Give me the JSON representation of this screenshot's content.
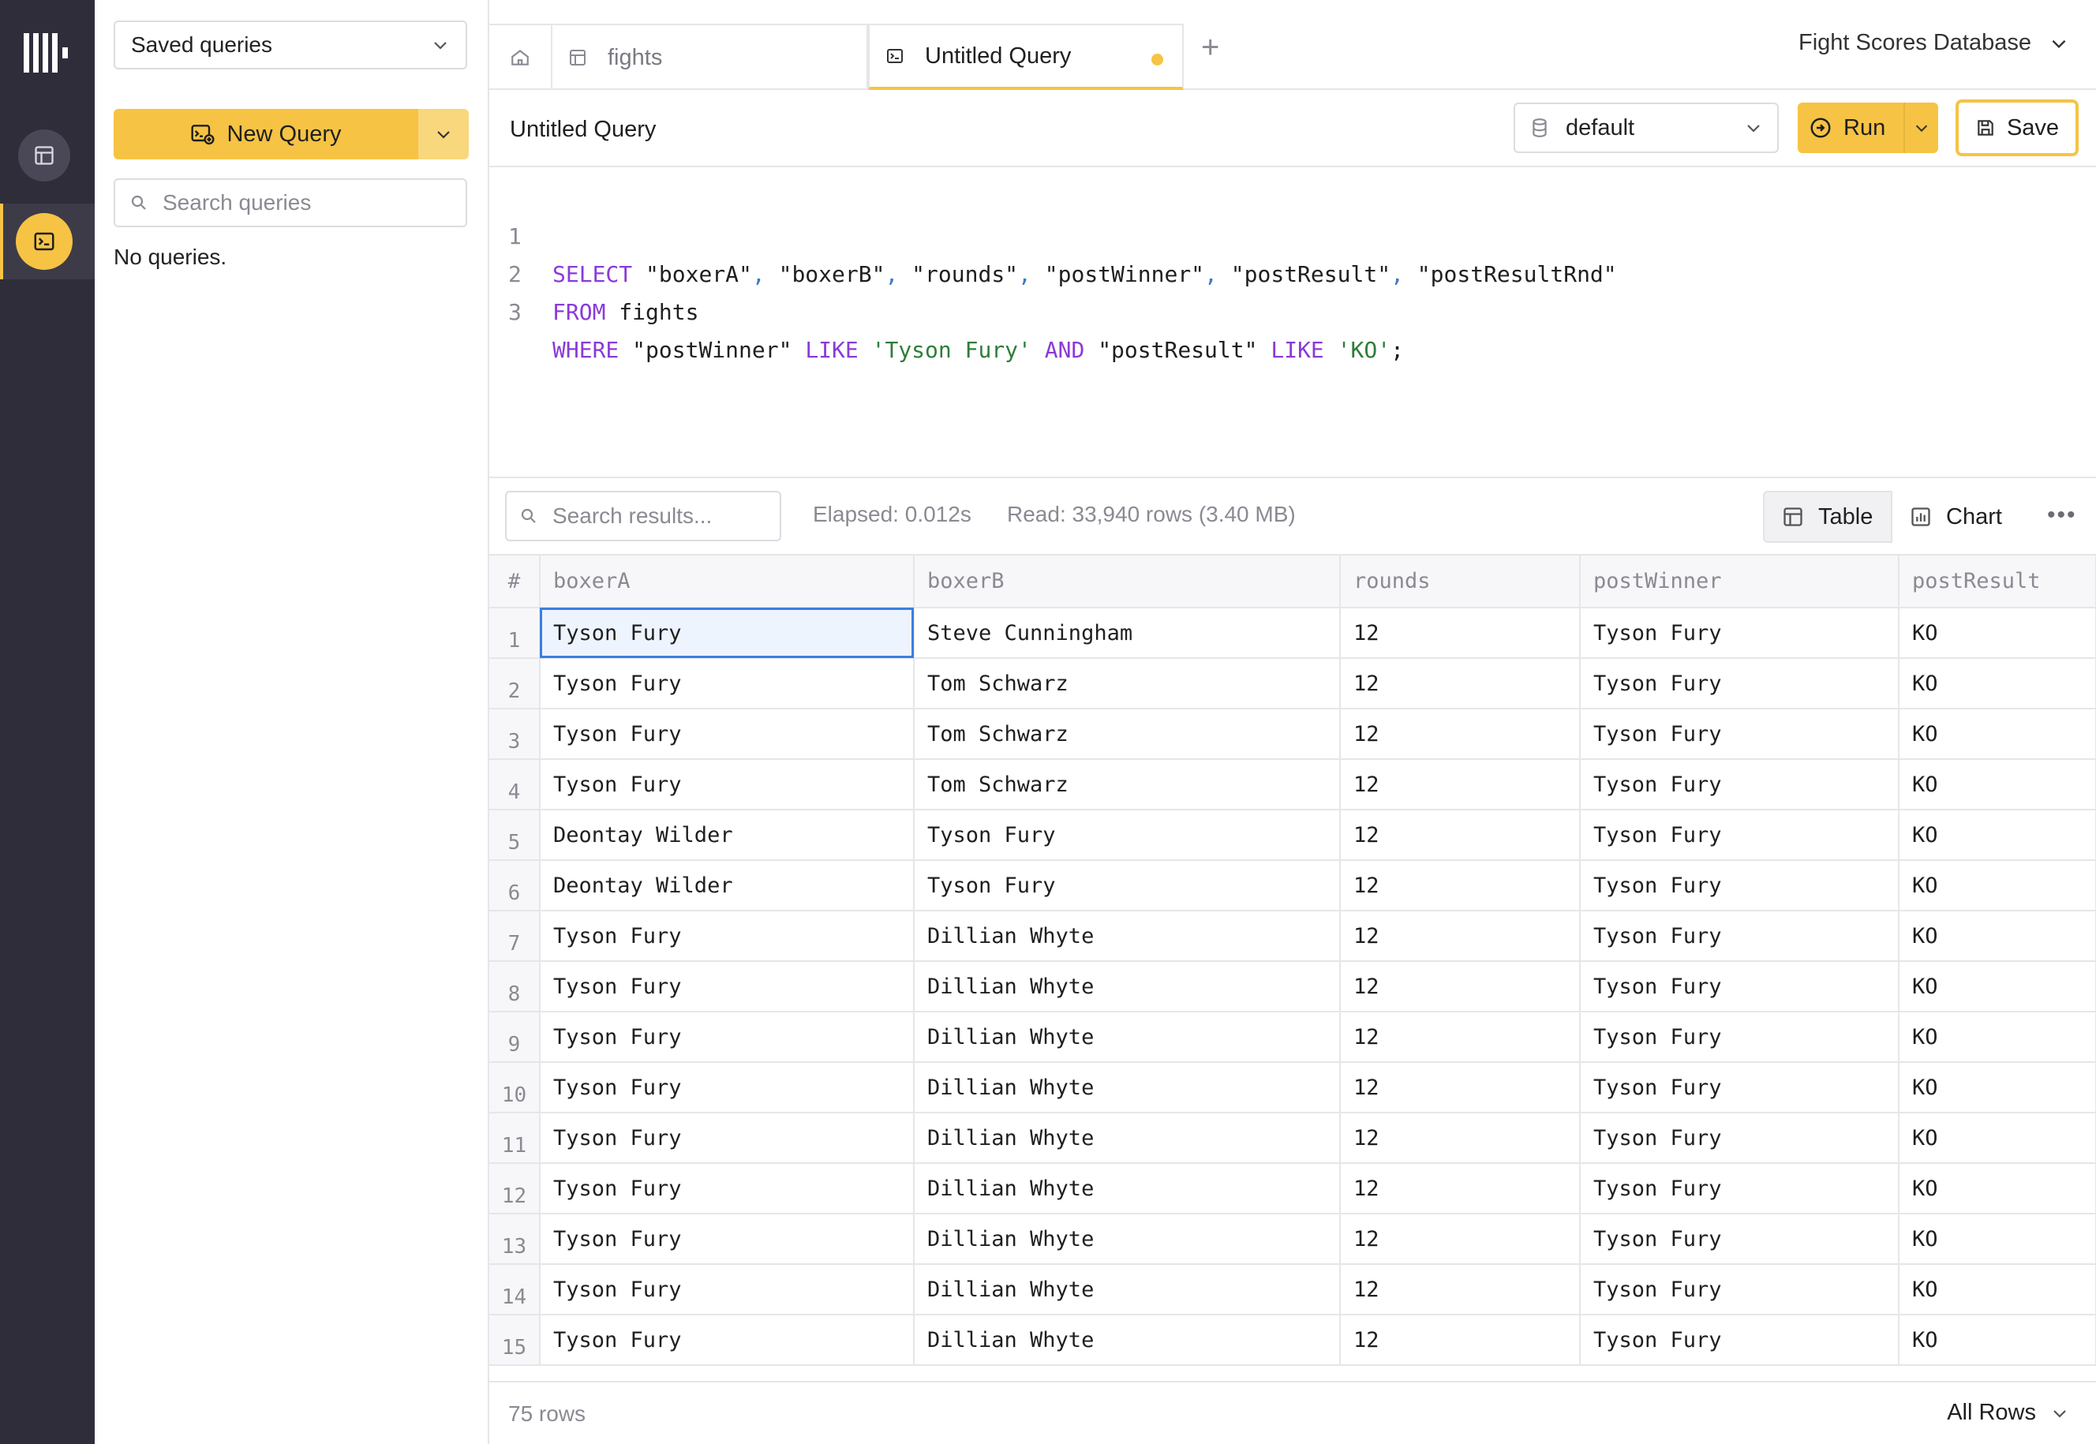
{
  "sidebar": {
    "saved_select_label": "Saved queries",
    "new_query_label": "New Query",
    "search_placeholder": "Search queries",
    "empty_text": "No queries."
  },
  "tabs": {
    "fights_label": "fights",
    "untitled_label": "Untitled Query",
    "database_label": "Fight Scores Database"
  },
  "query": {
    "title": "Untitled Query",
    "database": "default",
    "run_label": "Run",
    "save_label": "Save",
    "lines": [
      [
        "1",
        "SELECT \"boxerA\", \"boxerB\", \"rounds\", \"postWinner\", \"postResult\", \"postResultRnd\""
      ],
      [
        "2",
        "FROM fights"
      ],
      [
        "3",
        "WHERE \"postWinner\" LIKE 'Tyson Fury' AND \"postResult\" LIKE 'KO';"
      ]
    ]
  },
  "results": {
    "search_placeholder": "Search results...",
    "elapsed": "Elapsed: 0.012s",
    "read": "Read: 33,940 rows (3.40 MB)",
    "table_label": "Table",
    "chart_label": "Chart",
    "columns": [
      "#",
      "boxerA",
      "boxerB",
      "rounds",
      "postWinner",
      "postResult"
    ],
    "rows": [
      [
        "1",
        "Tyson Fury",
        "Steve Cunningham",
        "12",
        "Tyson Fury",
        "KO"
      ],
      [
        "2",
        "Tyson Fury",
        "Tom Schwarz",
        "12",
        "Tyson Fury",
        "KO"
      ],
      [
        "3",
        "Tyson Fury",
        "Tom Schwarz",
        "12",
        "Tyson Fury",
        "KO"
      ],
      [
        "4",
        "Tyson Fury",
        "Tom Schwarz",
        "12",
        "Tyson Fury",
        "KO"
      ],
      [
        "5",
        "Deontay Wilder",
        "Tyson Fury",
        "12",
        "Tyson Fury",
        "KO"
      ],
      [
        "6",
        "Deontay Wilder",
        "Tyson Fury",
        "12",
        "Tyson Fury",
        "KO"
      ],
      [
        "7",
        "Tyson Fury",
        "Dillian Whyte",
        "12",
        "Tyson Fury",
        "KO"
      ],
      [
        "8",
        "Tyson Fury",
        "Dillian Whyte",
        "12",
        "Tyson Fury",
        "KO"
      ],
      [
        "9",
        "Tyson Fury",
        "Dillian Whyte",
        "12",
        "Tyson Fury",
        "KO"
      ],
      [
        "10",
        "Tyson Fury",
        "Dillian Whyte",
        "12",
        "Tyson Fury",
        "KO"
      ],
      [
        "11",
        "Tyson Fury",
        "Dillian Whyte",
        "12",
        "Tyson Fury",
        "KO"
      ],
      [
        "12",
        "Tyson Fury",
        "Dillian Whyte",
        "12",
        "Tyson Fury",
        "KO"
      ],
      [
        "13",
        "Tyson Fury",
        "Dillian Whyte",
        "12",
        "Tyson Fury",
        "KO"
      ],
      [
        "14",
        "Tyson Fury",
        "Dillian Whyte",
        "12",
        "Tyson Fury",
        "KO"
      ],
      [
        "15",
        "Tyson Fury",
        "Dillian Whyte",
        "12",
        "Tyson Fury",
        "KO"
      ]
    ],
    "row_count": "75 rows",
    "all_rows_label": "All Rows"
  },
  "colors": {
    "accent": "#f6c344",
    "rail": "#2f2d3a",
    "keyword": "#8a3ad8",
    "string": "#2f7d3a",
    "selection": "#3b7fe0"
  }
}
